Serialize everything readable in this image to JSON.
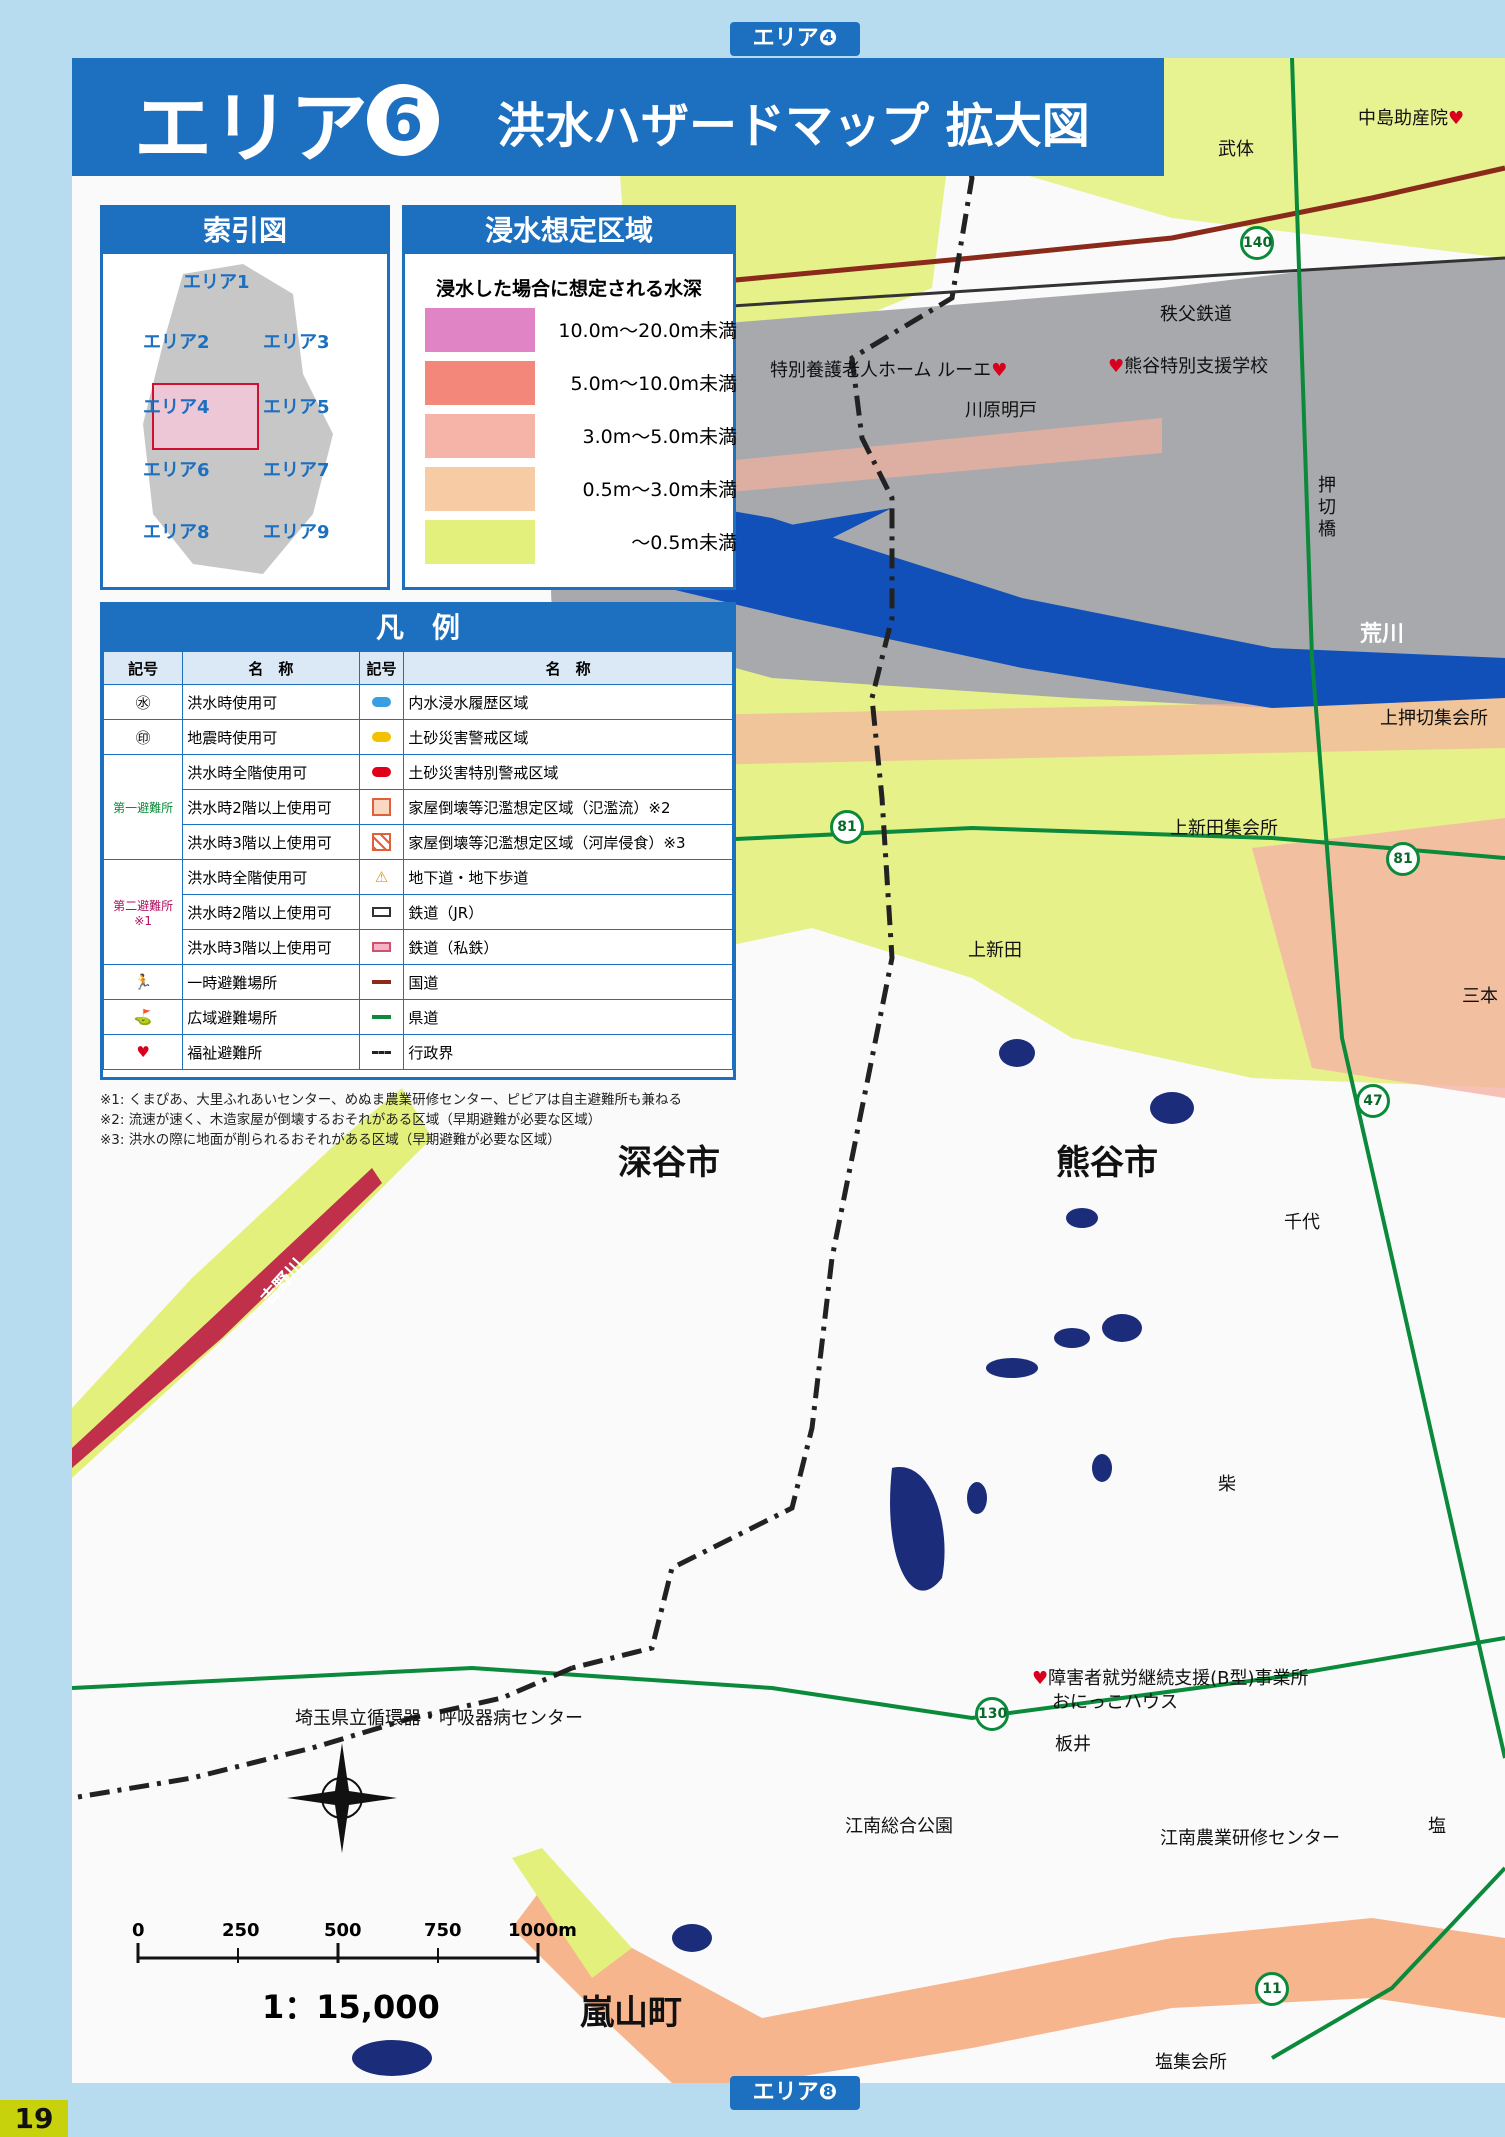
{
  "page": {
    "area_top_tab": "エリア❹",
    "area_bottom_tab": "エリア❽",
    "page_number": "19"
  },
  "title": {
    "main": "エリア",
    "number": "6",
    "sub": "洪水ハザードマップ 拡大図"
  },
  "index_panel": {
    "heading": "索引図",
    "cells": [
      "エリア1",
      "エリア2",
      "エリア3",
      "エリア4",
      "エリア5",
      "エリア6",
      "エリア7",
      "エリア8",
      "エリア9"
    ],
    "current": "エリア6"
  },
  "depth_panel": {
    "heading": "浸水想定区域",
    "caption": "浸水した場合に想定される水深",
    "ranges": [
      {
        "label": "10.0m～20.0m未満",
        "color": "#e184c6"
      },
      {
        "label": "5.0m～10.0m未満",
        "color": "#f3877a"
      },
      {
        "label": "3.0m～5.0m未満",
        "color": "#f6b3a8"
      },
      {
        "label": "0.5m～3.0m未満",
        "color": "#f7cba3"
      },
      {
        "label": "～0.5m未満",
        "color": "#e3f07c"
      }
    ]
  },
  "legend": {
    "heading": "凡　例",
    "col_symbol": "記号",
    "col_name": "名　称",
    "left": [
      {
        "name": "洪水時使用可",
        "icon": "water-circle-icon"
      },
      {
        "name": "地震時使用可",
        "icon": "earth-circle-icon"
      },
      {
        "group": "第一避難所",
        "name": "洪水時全階使用可",
        "icon": "shelter1-icon"
      },
      {
        "group": "第一避難所",
        "name": "洪水時2階以上使用可",
        "icon": "shelter1-2f-icon"
      },
      {
        "group": "第一避難所",
        "name": "洪水時3階以上使用可",
        "icon": "shelter1-3f-icon"
      },
      {
        "group": "第二避難所",
        "name": "洪水時全階使用可",
        "icon": "shelter2-icon"
      },
      {
        "group": "第二避難所",
        "name": "洪水時2階以上使用可",
        "icon": "shelter2-2f-icon"
      },
      {
        "group": "第二避難所",
        "name": "洪水時3階以上使用可",
        "icon": "shelter2-3f-icon"
      },
      {
        "name": "一時避難場所",
        "icon": "temporary-evacuation-icon"
      },
      {
        "name": "広域避難場所",
        "icon": "wide-area-evacuation-icon"
      },
      {
        "name": "福祉避難所",
        "icon": "heart-icon"
      }
    ],
    "group_first": "第一避難所",
    "group_second": "第二避難所",
    "note_mark": "※1",
    "right": [
      {
        "name": "内水浸水履歴区域",
        "color": "#3a9fe0"
      },
      {
        "name": "土砂災害警戒区域",
        "color": "#f2c200"
      },
      {
        "name": "土砂災害特別警戒区域",
        "color": "#e0001a"
      },
      {
        "name": "家屋倒壊等氾濫想定区域（氾濫流）※2",
        "color": "#f0b090"
      },
      {
        "name": "家屋倒壊等氾濫想定区域（河岸侵食）※3",
        "color": "#e0603a"
      },
      {
        "name": "地下道・地下歩道",
        "color": "#f2d200"
      },
      {
        "name": "鉄道（JR）",
        "color": "#333333"
      },
      {
        "name": "鉄道（私鉄）",
        "color": "#d05070"
      },
      {
        "name": "国道",
        "color": "#8a2a1a"
      },
      {
        "name": "県道",
        "color": "#0a8a3a"
      },
      {
        "name": "行政界",
        "color": "#222222"
      }
    ]
  },
  "notes": [
    "※1: くまぴあ、大里ふれあいセンター、めぬま農業研修センター、ピピアは自主避難所も兼ねる",
    "※2: 流速が速く、木造家屋が倒壊するおそれがある区域（早期避難が必要な区域）",
    "※3: 洪水の際に地面が削られるおそれがある区域（早期避難が必要な区域）"
  ],
  "map_labels": {
    "nakajima": "中島助産院",
    "takeitai": "武体",
    "chichibu": "秩父鉄道",
    "ruue": "特別養護老人ホーム ルーエ",
    "kumagaya_school": "熊谷特別支援学校",
    "kawara": "川原明戸",
    "oshikiri_bridge": "押切橋",
    "arakawa": "荒川",
    "kami_oshikiri": "上押切集会所",
    "kami_shinden_hall": "上新田集会所",
    "kami_shinden": "上新田",
    "sanbon": "三本",
    "fukaya": "深谷市",
    "kumagaya": "熊谷市",
    "chiyo": "千代",
    "yoshinogawa": "吉野川",
    "shiba": "柴",
    "saitama_center": "埼玉県立循環器・呼吸器病センター",
    "welfare_office_1": "障害者就労継続支援(B型)事業所",
    "welfare_office_2": "おにっこハウス",
    "itai": "板井",
    "konan_park": "江南総合公園",
    "konan_center": "江南農業研修センター",
    "shio": "塩",
    "shio_hall": "塩集会所",
    "ranzan": "嵐山町"
  },
  "routes": [
    "140",
    "81",
    "81",
    "47",
    "130",
    "11"
  ],
  "scale": {
    "ticks": [
      "0",
      "250",
      "500",
      "750",
      "1000m"
    ],
    "ratio": "1：15,000"
  }
}
